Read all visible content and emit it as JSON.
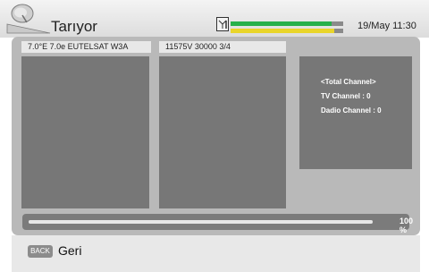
{
  "header": {
    "title": "Tarıyor",
    "datetime": "19/May 11:30",
    "signal": {
      "strength_color": "#27b04a",
      "quality_color": "#e9d52a",
      "strength_level": 0.9,
      "quality_level": 0.92
    }
  },
  "scan": {
    "satellite": "7.0°E 7.0e EUTELSAT W3A",
    "transponder": "11575V 30000 3/4"
  },
  "summary": {
    "heading": "<Total Channel>",
    "tv": "TV Channel : 0",
    "radio": "Dadio Channel : 0"
  },
  "progress": {
    "value": 1.0,
    "label": "100 %"
  },
  "footer": {
    "back_key": "BACK",
    "back_label": "Geri"
  }
}
